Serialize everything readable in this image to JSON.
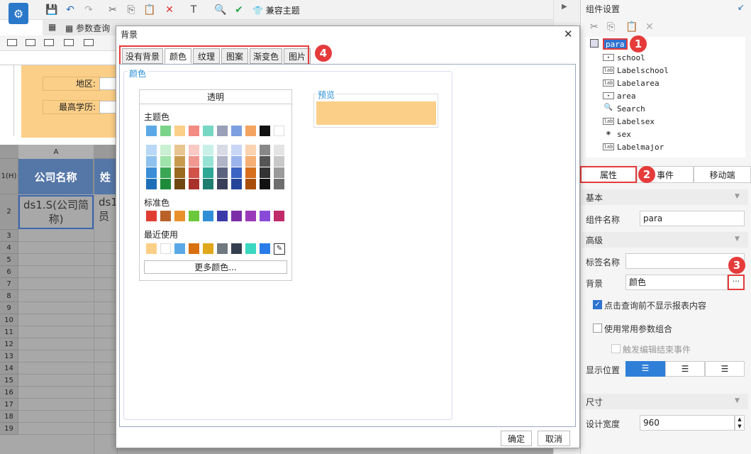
{
  "toolbar": {
    "compat_theme": "兼容主题",
    "param_tab": "参数查询"
  },
  "para_panel": {
    "area_label": "地区:",
    "edu_label": "最高学历:"
  },
  "grid": {
    "col_a": "A",
    "rows": [
      "1(H)",
      "2",
      "3",
      "4",
      "5",
      "6",
      "7",
      "8",
      "9",
      "10",
      "11",
      "12",
      "13",
      "14",
      "15",
      "16",
      "17",
      "18",
      "19"
    ],
    "header_cell": "公司名称",
    "header_cell_b": "姓",
    "data_cell": "ds1.S(公司简称)",
    "data_cell_b": "ds1员"
  },
  "right": {
    "title": "组件设置",
    "tree": [
      {
        "label": "para",
        "icon": "para"
      },
      {
        "label": "school",
        "icon": "combo"
      },
      {
        "label": "Labelschool",
        "icon": "lab"
      },
      {
        "label": "Labelarea",
        "icon": "lab"
      },
      {
        "label": "area",
        "icon": "combo"
      },
      {
        "label": "Search",
        "icon": "search"
      },
      {
        "label": "Labelsex",
        "icon": "lab"
      },
      {
        "label": "sex",
        "icon": "radio"
      },
      {
        "label": "Labelmajor",
        "icon": "lab"
      }
    ],
    "tabs": [
      "属性",
      "事件",
      "移动端"
    ],
    "basic": "基本",
    "name_label": "组件名称",
    "name_value": "para",
    "advanced": "高级",
    "tag_label": "标签名称",
    "tag_value": "",
    "bg_label": "背景",
    "bg_value": "颜色",
    "more_btn": "···",
    "chk1": "点击查询前不显示报表内容",
    "chk2": "使用常用参数组合",
    "chk3": "触发编辑结束事件",
    "pos_label": "显示位置",
    "size": "尺寸",
    "width_label": "设计宽度",
    "width_value": "960",
    "badges": [
      "1",
      "2",
      "3",
      "4"
    ]
  },
  "dialog": {
    "title": "背景",
    "close": "✕",
    "tabs": [
      "没有背景",
      "颜色",
      "纹理",
      "图案",
      "渐变色",
      "图片"
    ],
    "group": "颜色",
    "transparent": "透明",
    "theme": "主题色",
    "standard": "标准色",
    "recent": "最近使用",
    "more": "更多颜色...",
    "preview": "预览",
    "ok": "确定",
    "cancel": "取消",
    "preview_color": "#fbcf88",
    "theme_top": [
      "#5aa9e6",
      "#7bd389",
      "#fbcf88",
      "#f28b82",
      "#76d7c4",
      "#9aa0b8",
      "#7c9fe0",
      "#f4a460",
      "#111111",
      "#ffffff"
    ],
    "theme_cols": [
      [
        "#b8d8f5",
        "#8fc2ee",
        "#3b8ed6",
        "#1f6fb8"
      ],
      [
        "#c9f0d0",
        "#9ee3ab",
        "#3aa655",
        "#1f8a3a"
      ],
      [
        "#e8c590",
        "#c89a4e",
        "#9a6a20",
        "#6e4810"
      ],
      [
        "#f8c9c5",
        "#f09890",
        "#d05248",
        "#a8322a"
      ],
      [
        "#c8f0e8",
        "#96e2d4",
        "#2fa896",
        "#1e7e70"
      ],
      [
        "#d8dae4",
        "#b0b4c6",
        "#5c6380",
        "#3a405a"
      ],
      [
        "#c8d6f5",
        "#9cb4ec",
        "#3c64c4",
        "#24449a"
      ],
      [
        "#fad2b0",
        "#f5ae74",
        "#d86e1c",
        "#a84e0c"
      ],
      [
        "#888888",
        "#555555",
        "#333333",
        "#111111"
      ],
      [
        "#e4e4e4",
        "#c8c8c8",
        "#9a9a9a",
        "#6e6e6e"
      ]
    ],
    "standard_colors": [
      "#e03c31",
      "#b8622a",
      "#e8912a",
      "#6ac83a",
      "#2e8fd8",
      "#3a3aa8",
      "#7c2ea8",
      "#9b3ab8",
      "#8a4ad8",
      "#c02a6a"
    ],
    "recent_colors": [
      "#fbcf88",
      "#ffffff",
      "#5aa9e6",
      "#d87010",
      "#e0a81a",
      "#707880",
      "#344050",
      "#3ad8c0",
      "#2a7ce8"
    ]
  }
}
